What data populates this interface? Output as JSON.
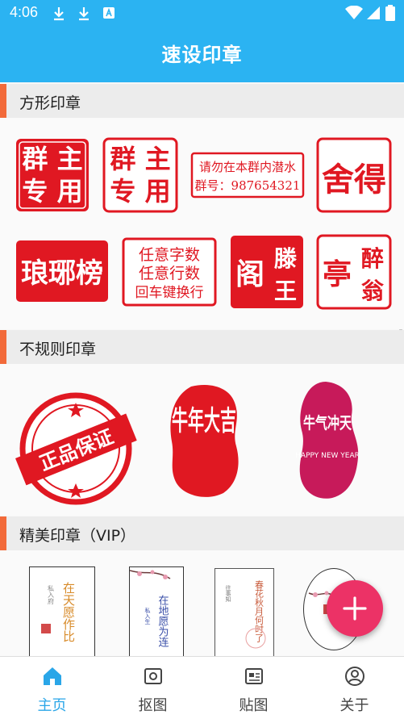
{
  "status_bar": {
    "time": "4:06"
  },
  "app_bar": {
    "title": "速设印章"
  },
  "sections": {
    "square": {
      "title": "方形印章",
      "seals": [
        {
          "lines": [
            "群 主",
            "专 用"
          ]
        },
        {
          "lines": [
            "群 主",
            "专 用"
          ]
        },
        {
          "lines": [
            "请勿在本群内潜水",
            "群号：987654321"
          ]
        },
        {
          "lines": [
            "舍得"
          ]
        },
        {
          "lines": [
            "琅琊榜"
          ]
        },
        {
          "lines": [
            "任意字数",
            "任意行数",
            "回车键换行"
          ]
        },
        {
          "lines": [
            "阁",
            "滕",
            "王"
          ]
        },
        {
          "lines": [
            "亭",
            "醉",
            "翁"
          ]
        }
      ]
    },
    "irregular": {
      "title": "不规则印章",
      "seals": [
        {
          "text": "正品保证"
        },
        {
          "text": "牛年大吉"
        },
        {
          "text": "牛气冲天",
          "subtext": "HAPPY NEW YEAR"
        }
      ]
    },
    "vip": {
      "title": "精美印章（VIP）",
      "items": [
        {
          "text": "在天愿作比"
        },
        {
          "text": "在地愿为连"
        },
        {
          "text": "春花秋月何时了"
        },
        {
          "text": ""
        }
      ]
    }
  },
  "fab": {
    "icon": "plus-icon"
  },
  "nav": {
    "items": [
      {
        "label": "主页",
        "icon": "home-icon",
        "active": true
      },
      {
        "label": "抠图",
        "icon": "crop-icon",
        "active": false
      },
      {
        "label": "贴图",
        "icon": "sticker-icon",
        "active": false
      },
      {
        "label": "关于",
        "icon": "about-icon",
        "active": false
      }
    ]
  },
  "colors": {
    "accent": "#2bb3f2",
    "seal_red": "#e01822",
    "fab": "#ec3266",
    "section_bar": "#f26a3a",
    "nav_active": "#2aa6e8"
  }
}
